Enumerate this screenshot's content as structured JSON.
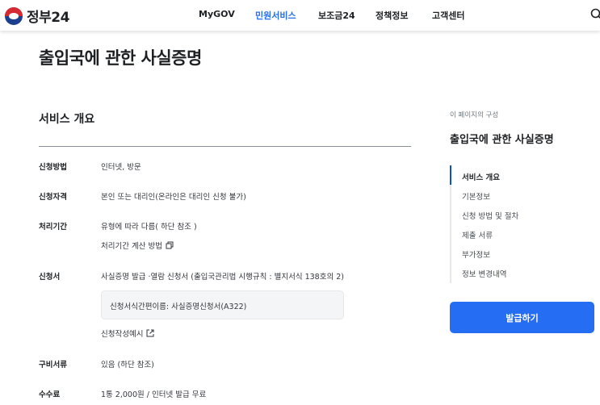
{
  "header": {
    "logo_text": "정부24",
    "nav": [
      "MyGOV",
      "민원서비스",
      "보조금24",
      "정책정보",
      "고객센터"
    ],
    "active_nav": "민원서비스",
    "accent_color": "#256ef4"
  },
  "page": {
    "title": "출입국에 관한 사실증명"
  },
  "overview": {
    "section_title": "서비스 개요",
    "rows": {
      "method": {
        "label": "신청방법",
        "value": "인터넷, 방문"
      },
      "eligibility": {
        "label": "신청자격",
        "value": "본인 또는 대리인(온라인은 대리인 신청 불가)"
      },
      "period": {
        "label": "처리기간",
        "value": "유형에 따라 다름( 하단 참조 )",
        "link": "처리기간 계산 방법"
      },
      "form": {
        "label": "신청서",
        "value": "사실증명 발급 ·열람 신청서 (출입국관리법 시행규칙 : 별지서식 138호의 2)",
        "box": "신청서식간편이름: 사실증명신청서(A322)",
        "link": "신청작성예시"
      },
      "documents": {
        "label": "구비서류",
        "value": "있음 (하단 참조)"
      },
      "fee": {
        "label": "수수료",
        "value": "1통 2,000원 / 인터넷 발급 무료"
      }
    }
  },
  "toc": {
    "caption": "이 페이지의 구성",
    "title": "출입국에 관한 사실증명",
    "items": [
      "서비스 개요",
      "기본정보",
      "신청 방법 및 절차",
      "제출 서류",
      "부가정보",
      "정보 변경내역"
    ],
    "active_item": "서비스 개요"
  },
  "apply_button": "발급하기",
  "icons": {
    "search": "search-icon",
    "copy": "copy-icon",
    "external": "external-link-icon"
  }
}
